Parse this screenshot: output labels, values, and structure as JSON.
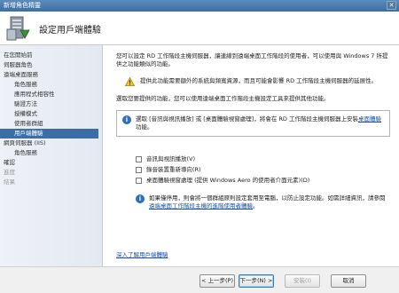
{
  "window": {
    "title": "新增角色精靈",
    "close_glyph": "✕"
  },
  "header": {
    "title": "設定用戶端體驗",
    "icon": "server-role-icon"
  },
  "sidebar": {
    "items": [
      {
        "label": "在您開始前",
        "level": 1,
        "state": "normal"
      },
      {
        "label": "伺服器角色",
        "level": 1,
        "state": "normal"
      },
      {
        "label": "遠端桌面服務",
        "level": 1,
        "state": "normal"
      },
      {
        "label": "角色服務",
        "level": 2,
        "state": "normal"
      },
      {
        "label": "應用程式相容性",
        "level": 2,
        "state": "normal"
      },
      {
        "label": "驗證方法",
        "level": 2,
        "state": "normal"
      },
      {
        "label": "授權模式",
        "level": 2,
        "state": "normal"
      },
      {
        "label": "使用者群組",
        "level": 2,
        "state": "normal"
      },
      {
        "label": "用戶端體驗",
        "level": 2,
        "state": "selected"
      },
      {
        "label": "網頁伺服器 (IIS)",
        "level": 1,
        "state": "normal"
      },
      {
        "label": "角色服務",
        "level": 2,
        "state": "normal"
      },
      {
        "label": "確認",
        "level": 1,
        "state": "normal"
      },
      {
        "label": "進度",
        "level": 1,
        "state": "disabled"
      },
      {
        "label": "結果",
        "level": 1,
        "state": "disabled"
      }
    ]
  },
  "main": {
    "intro": "您可以設定 RD 工作階段主機伺服器，讓連線到遠端桌面工作階段的使用者，可以使用與 Windows 7 所提供之功能類似的功能。",
    "warning": "提供此功能需要額外的系統與頻寬資源，而且可能會影響 RD 工作階段主機伺服器的延展性。",
    "select_prompt": "選取您要提供的功能，您可以使用遠端桌面工作階段主機設定工具來提供其他功能。",
    "info_text": "選取 [音訊與視訊播放] 或 [桌面體驗視窗處理]，將會在 RD 工作階段主機伺服器上安裝",
    "info_link": "桌面體驗",
    "info_suffix": "功能。",
    "checkboxes": [
      {
        "label": "音訊與視訊播放(V)",
        "checked": false
      },
      {
        "label": "錄音裝置重新導向(R)",
        "checked": false
      },
      {
        "label": "桌面體驗視窗處理 (提供 Windows Aero 的使用者介面元素)(D)",
        "checked": false
      }
    ],
    "note_text": "如果僅停用，則會將一個群組原則設定套用至電腦，以防止設定功能。如需詳細資訊，請參閱",
    "note_link": "遠端桌面工作階段主機的進階使用者體驗",
    "note_suffix": "。",
    "bottom_link": "深入了解用戶端體驗"
  },
  "footer": {
    "back": "< 上一步(P)",
    "next": "下一步(N) >",
    "install": "安裝(I)",
    "cancel": "取消"
  }
}
